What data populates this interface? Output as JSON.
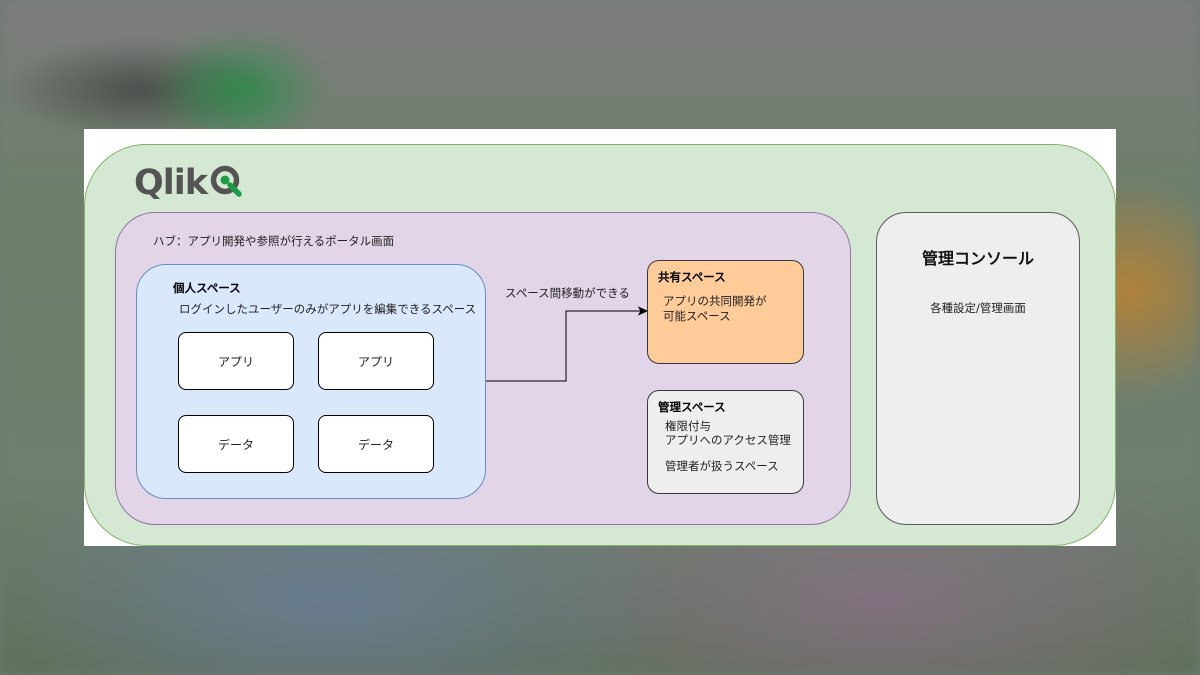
{
  "logo": {
    "text": "Qlik"
  },
  "hub": {
    "label": "ハブ：アプリ開発や参照が行えるポータル画面"
  },
  "personal_space": {
    "title": "個人スペース",
    "description": "ログインしたユーザーのみがアプリを編集できるスペース",
    "items": [
      "アプリ",
      "アプリ",
      "データ",
      "データ"
    ]
  },
  "move_label": "スペース間移動ができる",
  "shared_space": {
    "title": "共有スペース",
    "lines": [
      "アプリの共同開発が",
      "可能スペース"
    ]
  },
  "admin_space": {
    "title": "管理スペース",
    "lines": [
      "権限付与",
      "アプリへのアクセス管理"
    ],
    "note": "管理者が扱うスペース"
  },
  "console": {
    "title": "管理コンソール",
    "description": "各種設定/管理画面"
  },
  "colors": {
    "outer": "#d5e8d4",
    "hub": "#e1d5e7",
    "personal": "#dae8fc",
    "shared": "#ffcc99",
    "admin": "#eeeeee",
    "console": "#eeeeee",
    "logo_green": "#1e9b47",
    "logo_gray": "#545454"
  }
}
